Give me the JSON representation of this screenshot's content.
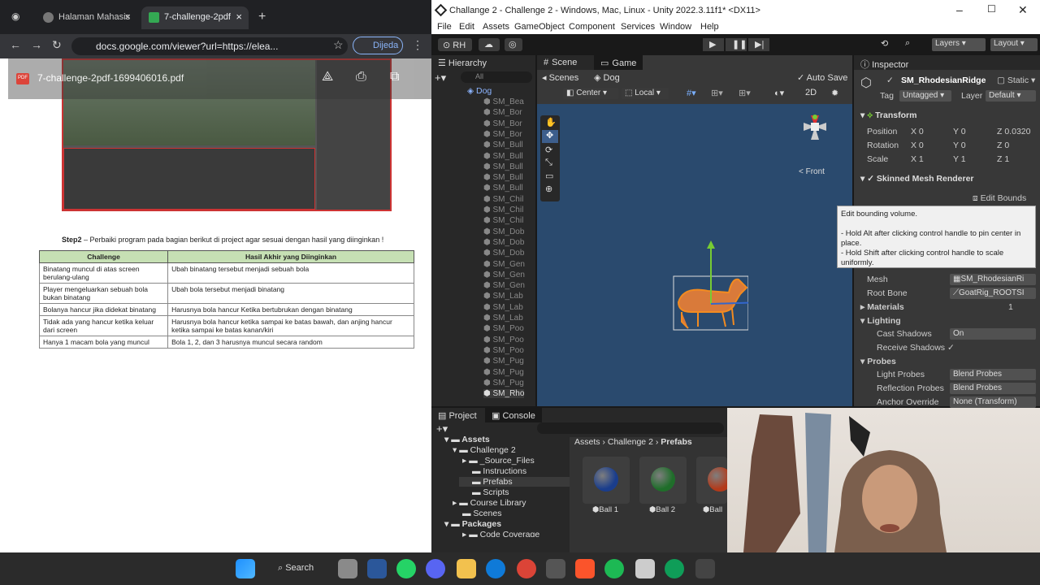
{
  "chrome": {
    "tab1": "Halaman Mahasis",
    "tab2": "7-challenge-2pdf",
    "url": "docs.google.com/viewer?url=https://elea...",
    "profile": "Dijeda",
    "pdf_title": "7-challenge-2pdf-1699406016.pdf"
  },
  "doc": {
    "step2_bold": "Step2",
    "step2_text": " – Perbaiki program pada bagian berikut di project agar sesuai dengan hasil yang diinginkan !",
    "headers": [
      "Challenge",
      "Hasil Akhir yang Diinginkan"
    ],
    "rows": [
      [
        "Binatang muncul di atas screen berulang-ulang",
        "Ubah binatang tersebut menjadi sebuah bola"
      ],
      [
        "Player mengeluarkan sebuah bola bukan binatang",
        "Ubah bola tersebut menjadi binatang"
      ],
      [
        "Bolanya hancur jika didekat binatang",
        "Harusnya bola hancur Ketika bertubrukan dengan binatang"
      ],
      [
        "Tidak ada yang hancur ketika keluar dari screen",
        "Harusnya bola hancur ketika sampai ke batas bawah, dan anjing hancur ketika sampai ke batas kanan/kiri"
      ],
      [
        "Hanya 1 macam bola yang muncul",
        "Bola 1, 2, dan 3 harusnya muncul secara random"
      ]
    ]
  },
  "unity": {
    "title": "Challange 2 - Challenge 2 - Windows, Mac, Linux - Unity 2022.3.11f1* <DX11>",
    "menu": [
      "File",
      "Edit",
      "Assets",
      "GameObject",
      "Component",
      "Services",
      "Window",
      "Help"
    ],
    "account": "RH",
    "layers": "Layers",
    "layout": "Layout",
    "hierarchy": "Hierarchy",
    "hier_search": "All",
    "hier_root": "Dog",
    "hier_items": [
      "SM_Bea",
      "SM_Bor",
      "SM_Bor",
      "SM_Bor",
      "SM_Bull",
      "SM_Bull",
      "SM_Bull",
      "SM_Bull",
      "SM_Bull",
      "SM_Chil",
      "SM_Chil",
      "SM_Chil",
      "SM_Dob",
      "SM_Dob",
      "SM_Dob",
      "SM_Gen",
      "SM_Gen",
      "SM_Gen",
      "SM_Lab",
      "SM_Lab",
      "SM_Lab",
      "SM_Poo",
      "SM_Poo",
      "SM_Poo",
      "SM_Pug",
      "SM_Pug",
      "SM_Pug",
      "SM_Rho"
    ],
    "scene_tab": "Scene",
    "game_tab": "Game",
    "scenes": "Scenes",
    "scene_obj": "Dog",
    "auto_save": "Auto Save",
    "center": "Center",
    "local": "Local",
    "mode_2d": "2D",
    "front": "< Front",
    "inspector": "Inspector",
    "obj_name": "SM_RhodesianRidge",
    "static": "Static",
    "tag_label": "Tag",
    "tag": "Untagged",
    "layer_label": "Layer",
    "layer": "Default",
    "transform": "Transform",
    "position": "Position",
    "rotation": "Rotation",
    "scale": "Scale",
    "pos": [
      "0",
      "0",
      "0.0320"
    ],
    "rot": [
      "0",
      "0",
      "0"
    ],
    "scl": [
      "1",
      "1",
      "1"
    ],
    "smr": "Skinned Mesh Renderer",
    "edit_bounds": "Edit Bounds",
    "tooltip1": "Edit bounding volume.",
    "tooltip2": "- Hold Alt after clicking control handle to pin center in place.",
    "tooltip3": "- Hold Shift after clicking control handle to scale uniformly.",
    "mesh_label": "Mesh",
    "mesh": "SM_RhodesianRi",
    "root_bone_label": "Root Bone",
    "root_bone": "GoatRig_ROOTSI",
    "materials": "Materials",
    "materials_count": "1",
    "lighting": "Lighting",
    "cast_shadows_label": "Cast Shadows",
    "cast_shadows": "On",
    "receive_shadows": "Receive Shadows",
    "probes": "Probes",
    "light_probes_label": "Light Probes",
    "light_probes": "Blend Probes",
    "refl_probes_label": "Reflection Probes",
    "refl_probes": "Blend Probes",
    "anchor_label": "Anchor Override",
    "anchor": "None (Transform)",
    "project": "Project",
    "console": "Console",
    "tree": [
      "Assets",
      "Challenge 2",
      "_Source_Files",
      "Instructions",
      "Prefabs",
      "Scripts",
      "Course Library",
      "Scenes",
      "Packages",
      "Code Coverage"
    ],
    "breadcrumb": [
      "Assets",
      "Challenge 2",
      "Prefabs"
    ],
    "balls": [
      "Ball 1",
      "Ball 2",
      "Ball"
    ],
    "ball_colors": [
      "#1a3d8c",
      "#1f6e2a",
      "#b33a1a"
    ]
  },
  "taskbar": {
    "search": "Search"
  }
}
